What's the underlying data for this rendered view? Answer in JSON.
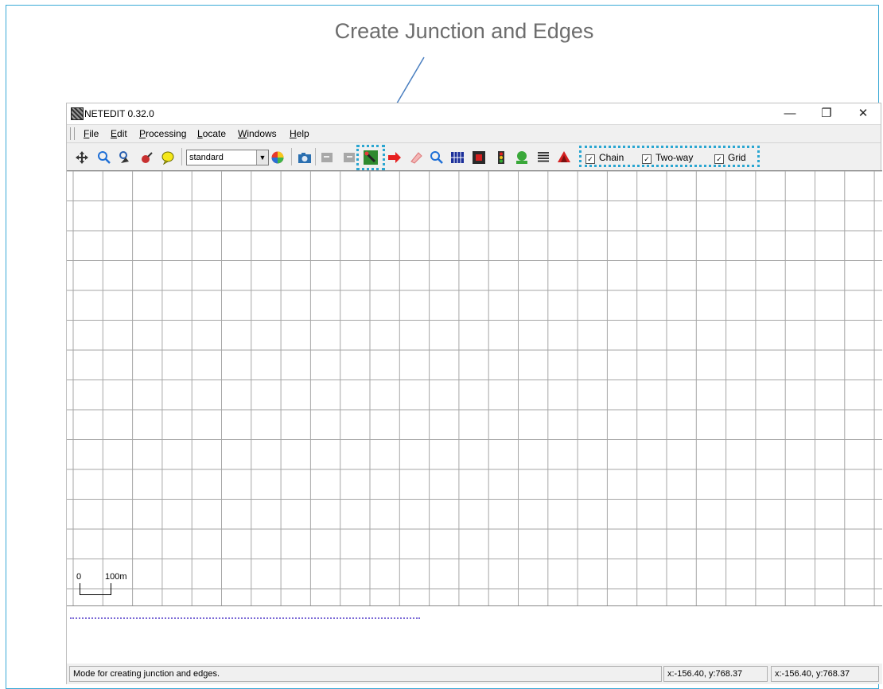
{
  "annotation": {
    "title": "Create Junction and Edges"
  },
  "window": {
    "title": "NETEDIT 0.32.0"
  },
  "window_controls": {
    "minimize": "—",
    "restore": "❐",
    "close": "✕"
  },
  "menu": {
    "items": [
      "File",
      "Edit",
      "Processing",
      "Locate",
      "Windows",
      "Help"
    ]
  },
  "toolbar": {
    "scheme_select": {
      "value": "standard"
    },
    "icons": [
      "move-icon",
      "zoom-icon",
      "locate-icon",
      "delete-icon",
      "inspect-icon",
      "color-wheel-icon",
      "camera-icon",
      "undo-icon",
      "redo-icon",
      "create-edge-icon",
      "move-mode-icon",
      "delete-mode-icon",
      "inspect-mode-icon",
      "select-mode-icon",
      "connection-icon",
      "traffic-light-icon",
      "additional-icon",
      "crossing-icon",
      "polygon-icon"
    ],
    "options": [
      {
        "label": "Chain",
        "checked": true
      },
      {
        "label": "Two-way",
        "checked": true
      },
      {
        "label": "Grid",
        "checked": true
      }
    ],
    "highlight_color": "#2aa6d1"
  },
  "canvas": {
    "scale_zero": "0",
    "scale_label": "100m",
    "grid_color": "#a6a6a6"
  },
  "status": {
    "message": "Mode for creating junction and edges.",
    "coord1": "x:-156.40, y:768.37",
    "coord2": "x:-156.40, y:768.37"
  }
}
